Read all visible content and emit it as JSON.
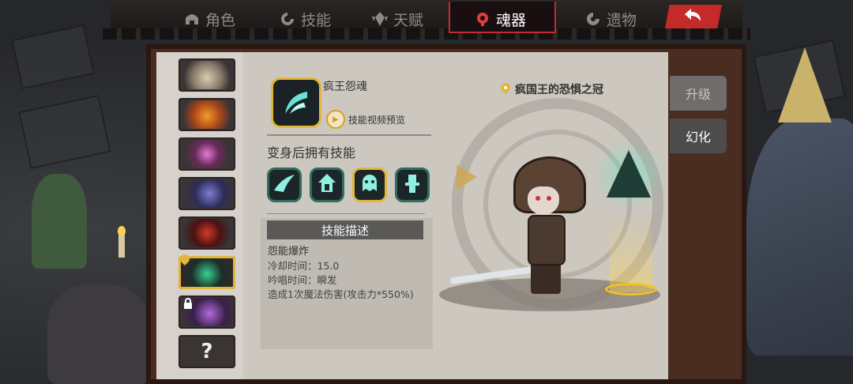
{
  "tabs": [
    {
      "label": "角色",
      "icon": "helmet-icon",
      "active": false
    },
    {
      "label": "技能",
      "icon": "skill-swirl-icon",
      "active": false
    },
    {
      "label": "天赋",
      "icon": "talent-gem-icon",
      "active": false
    },
    {
      "label": "魂器",
      "icon": "soul-vessel-icon",
      "active": true
    },
    {
      "label": "遗物",
      "icon": "relic-icon",
      "active": false
    }
  ],
  "back_button": {
    "icon": "back-arrow-icon"
  },
  "soul_list": [
    {
      "name": "horn-soul",
      "colors": [
        "#8a7b6a",
        "#d9cbb3"
      ]
    },
    {
      "name": "flame-armor-soul",
      "colors": [
        "#a8451b",
        "#f39a2a"
      ]
    },
    {
      "name": "eye-orb-soul",
      "colors": [
        "#6a2a5a",
        "#e07ad4"
      ]
    },
    {
      "name": "dark-claw-soul",
      "colors": [
        "#2d2d5a",
        "#7d7fd1"
      ]
    },
    {
      "name": "red-crystal-soul",
      "colors": [
        "#4a1212",
        "#d33a2a"
      ]
    },
    {
      "name": "madking-soul",
      "colors": [
        "#1b2e2a",
        "#3ad08f"
      ],
      "selected": true
    },
    {
      "name": "purple-beast-soul",
      "colors": [
        "#3a1f4a",
        "#b06ad9"
      ],
      "locked": true
    },
    {
      "name": "unknown-soul",
      "unknown_text": "?"
    }
  ],
  "side_buttons": {
    "upgrade": "升级",
    "illusion": "幻化"
  },
  "soul": {
    "name": "疯王怨魂",
    "video_preview": "技能视频预览",
    "crown": "疯国王的恐惧之冠"
  },
  "skills_section": {
    "title": "变身后拥有技能",
    "skills": [
      {
        "icon": "slash-wave-icon",
        "selected": false
      },
      {
        "icon": "summon-tower-icon",
        "selected": false
      },
      {
        "icon": "ghost-burst-icon",
        "selected": true
      },
      {
        "icon": "totem-icon",
        "selected": false
      }
    ]
  },
  "description": {
    "header": "技能描述",
    "skill_name": "怨能爆炸",
    "cooldown": "冷却时间：15.0",
    "cast_time": "吟唱时间：瞬发",
    "effect": "造成1次魔法伤害(攻击力*550%)"
  }
}
